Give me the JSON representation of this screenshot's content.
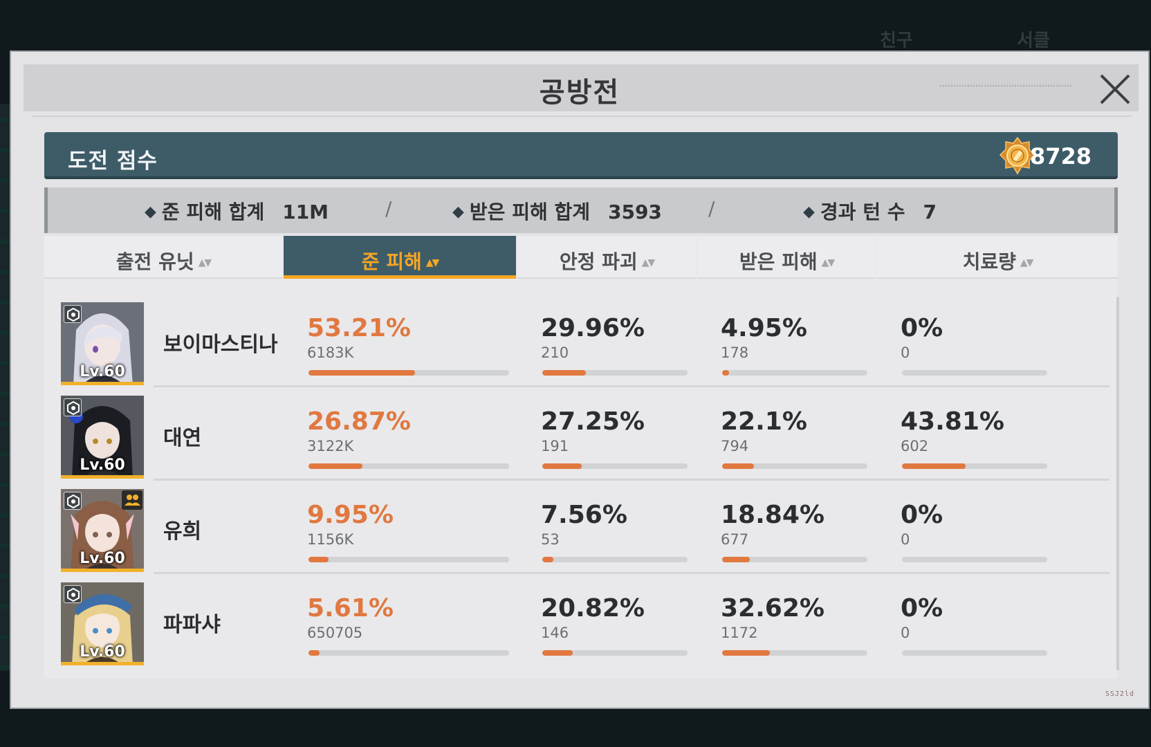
{
  "background": {
    "tab_friend": "친구",
    "tab_letter": "서클"
  },
  "dialog": {
    "title": "공방전",
    "close_icon": "close-x-icon"
  },
  "score": {
    "label": "도전 점수",
    "value": "8728",
    "icon": "gold-medal-icon"
  },
  "summary": {
    "damage_dealt_label": "준 피해 합계",
    "damage_dealt_value": "11M",
    "damage_taken_label": "받은 피해 합계",
    "damage_taken_value": "3593",
    "turns_label": "경과 턴 수",
    "turns_value": "7",
    "separator": "/"
  },
  "columns": [
    {
      "label": "출전 유닛",
      "active": false
    },
    {
      "label": "준 피해",
      "active": true
    },
    {
      "label": "안정 파괴",
      "active": false
    },
    {
      "label": "받은 피해",
      "active": false
    },
    {
      "label": "치료량",
      "active": false
    }
  ],
  "rows": [
    {
      "name": "보이마스티나",
      "level": "Lv.60",
      "support": false,
      "damage": {
        "pct": "53.21%",
        "raw": "6183K",
        "fill": 0.5321
      },
      "stability": {
        "pct": "29.96%",
        "raw": "210",
        "fill": 0.2996
      },
      "taken": {
        "pct": "4.95%",
        "raw": "178",
        "fill": 0.0495
      },
      "heal": {
        "pct": "0%",
        "raw": "0",
        "fill": 0
      }
    },
    {
      "name": "대연",
      "level": "Lv.60",
      "support": false,
      "damage": {
        "pct": "26.87%",
        "raw": "3122K",
        "fill": 0.2687
      },
      "stability": {
        "pct": "27.25%",
        "raw": "191",
        "fill": 0.2725
      },
      "taken": {
        "pct": "22.1%",
        "raw": "794",
        "fill": 0.221
      },
      "heal": {
        "pct": "43.81%",
        "raw": "602",
        "fill": 0.4381
      }
    },
    {
      "name": "유희",
      "level": "Lv.60",
      "support": true,
      "damage": {
        "pct": "9.95%",
        "raw": "1156K",
        "fill": 0.0995
      },
      "stability": {
        "pct": "7.56%",
        "raw": "53",
        "fill": 0.0756
      },
      "taken": {
        "pct": "18.84%",
        "raw": "677",
        "fill": 0.1884
      },
      "heal": {
        "pct": "0%",
        "raw": "0",
        "fill": 0
      }
    },
    {
      "name": "파파샤",
      "level": "Lv.60",
      "support": false,
      "damage": {
        "pct": "5.61%",
        "raw": "650705",
        "fill": 0.0561
      },
      "stability": {
        "pct": "20.82%",
        "raw": "146",
        "fill": 0.2082
      },
      "taken": {
        "pct": "32.62%",
        "raw": "1172",
        "fill": 0.3262
      },
      "heal": {
        "pct": "0%",
        "raw": "0",
        "fill": 0
      }
    }
  ],
  "footer": {
    "build_id": "SSJ2ld"
  },
  "colors": {
    "accent_orange": "#e07840",
    "header_teal": "#3e5c68",
    "active_yellow": "#f5a623"
  }
}
